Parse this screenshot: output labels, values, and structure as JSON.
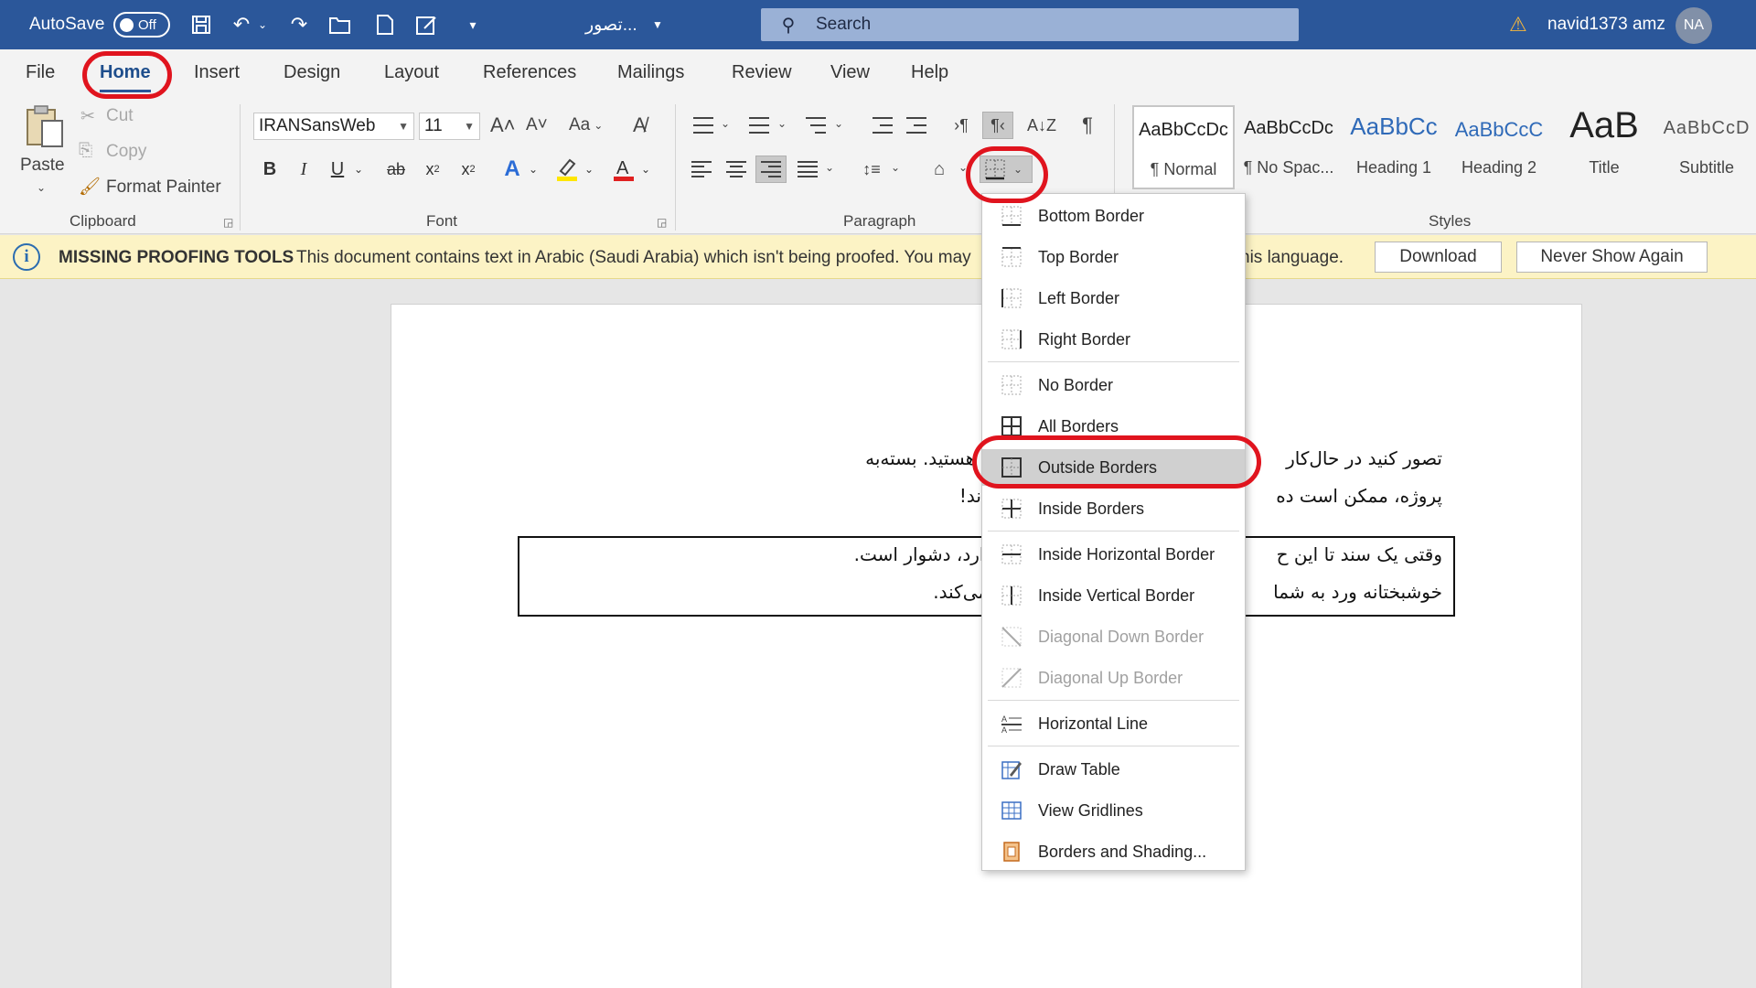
{
  "titlebar": {
    "autosave_label": "AutoSave",
    "autosave_state": "Off",
    "doc_title": "تصور...",
    "search_placeholder": "Search",
    "user_name": "navid1373 amz",
    "user_initials": "NA"
  },
  "menu": {
    "tabs": [
      "File",
      "Home",
      "Insert",
      "Design",
      "Layout",
      "References",
      "Mailings",
      "Review",
      "View",
      "Help"
    ],
    "active": "Home"
  },
  "ribbon": {
    "clipboard": {
      "paste": "Paste",
      "cut": "Cut",
      "copy": "Copy",
      "format_painter": "Format Painter",
      "label": "Clipboard"
    },
    "font": {
      "font_name": "IRANSansWeb",
      "font_size": "11",
      "change_case": "Aa",
      "label": "Font"
    },
    "paragraph": {
      "label": "Paragraph"
    },
    "styles": {
      "label": "Styles",
      "items": [
        {
          "preview": "AaBbCcDc",
          "name": "¶ Normal"
        },
        {
          "preview": "AaBbCcDc",
          "name": "¶ No Spac..."
        },
        {
          "preview": "AaBbCc",
          "name": "Heading 1"
        },
        {
          "preview": "AaBbCcC",
          "name": "Heading 2"
        },
        {
          "preview": "AaB",
          "name": "Title"
        },
        {
          "preview": "AaBbCcD",
          "name": "Subtitle"
        }
      ]
    }
  },
  "message_bar": {
    "title": "MISSING PROOFING TOOLS",
    "text_left": "This document contains text in Arabic (Saudi Arabia) which isn't being proofed. You may",
    "text_right": "his language.",
    "download": "Download",
    "never_show": "Never Show Again"
  },
  "document": {
    "line1_right": "تصور کنید در حال‌کار",
    "line1_left": "فت ورد مانند مقاله‌ی دانشگاهی هستید. بسته‌به",
    "line2_right": "پروژه، ممکن است ده",
    "line2_left": "ند!",
    "box_line1_right": "وقتی یک سند تا این ح",
    "box_line1_left": "ینکه کدام صفحه چه اطلاعاتی دارد، دشوار است.",
    "box_line2_right": "خوشبختانه ورد به شما",
    "box_line2_left": "ی‌دهد که پیمایش سند را آسان می‌کند."
  },
  "borders_menu": {
    "items": [
      {
        "label": "Bottom Border",
        "icon": "bottom-border-icon"
      },
      {
        "label": "Top Border",
        "icon": "top-border-icon"
      },
      {
        "label": "Left Border",
        "icon": "left-border-icon"
      },
      {
        "label": "Right Border",
        "icon": "right-border-icon"
      },
      {
        "label": "No Border",
        "icon": "no-border-icon"
      },
      {
        "label": "All Borders",
        "icon": "all-borders-icon"
      },
      {
        "label": "Outside Borders",
        "icon": "outside-borders-icon",
        "highlighted": true
      },
      {
        "label": "Inside Borders",
        "icon": "inside-borders-icon"
      },
      {
        "label": "Inside Horizontal Border",
        "icon": "inside-horizontal-border-icon"
      },
      {
        "label": "Inside Vertical Border",
        "icon": "inside-vertical-border-icon"
      },
      {
        "label": "Diagonal Down Border",
        "icon": "diagonal-down-border-icon",
        "disabled": true
      },
      {
        "label": "Diagonal Up Border",
        "icon": "diagonal-up-border-icon",
        "disabled": true
      },
      {
        "label": "Horizontal Line",
        "icon": "horizontal-line-icon"
      },
      {
        "label": "Draw Table",
        "icon": "draw-table-icon"
      },
      {
        "label": "View Gridlines",
        "icon": "view-gridlines-icon"
      },
      {
        "label": "Borders and Shading...",
        "icon": "borders-shading-icon"
      }
    ]
  },
  "colors": {
    "accent": "#2b579a",
    "annotation": "#e0141e",
    "highlight_yellow": "#ffe600",
    "font_red": "#e02020",
    "message_bar": "#fcf3c5"
  }
}
